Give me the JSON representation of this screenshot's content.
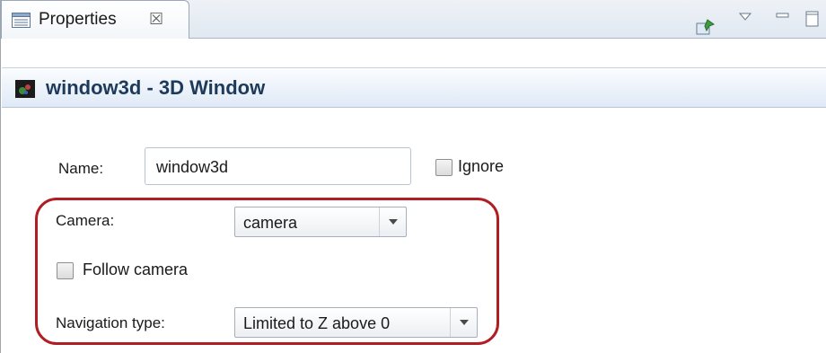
{
  "tab": {
    "label": "Properties",
    "close_glyph": "☒",
    "icon": "properties-icon"
  },
  "toolbar": {
    "icons": [
      "pin-icon",
      "view-menu-icon",
      "minimize-icon",
      "maximize-icon"
    ]
  },
  "title": {
    "text": "window3d - 3D Window",
    "icon": "window3d-icon"
  },
  "form": {
    "name_label": "Name:",
    "name_value": "window3d",
    "ignore_label": "Ignore",
    "ignore_checked": false,
    "camera_label": "Camera:",
    "camera_value": "camera",
    "follow_label": "Follow camera",
    "follow_checked": false,
    "navigation_label": "Navigation type:",
    "navigation_value": "Limited to Z above 0"
  },
  "colors": {
    "highlight": "#b01e23",
    "title_text": "#1e3a5a"
  }
}
